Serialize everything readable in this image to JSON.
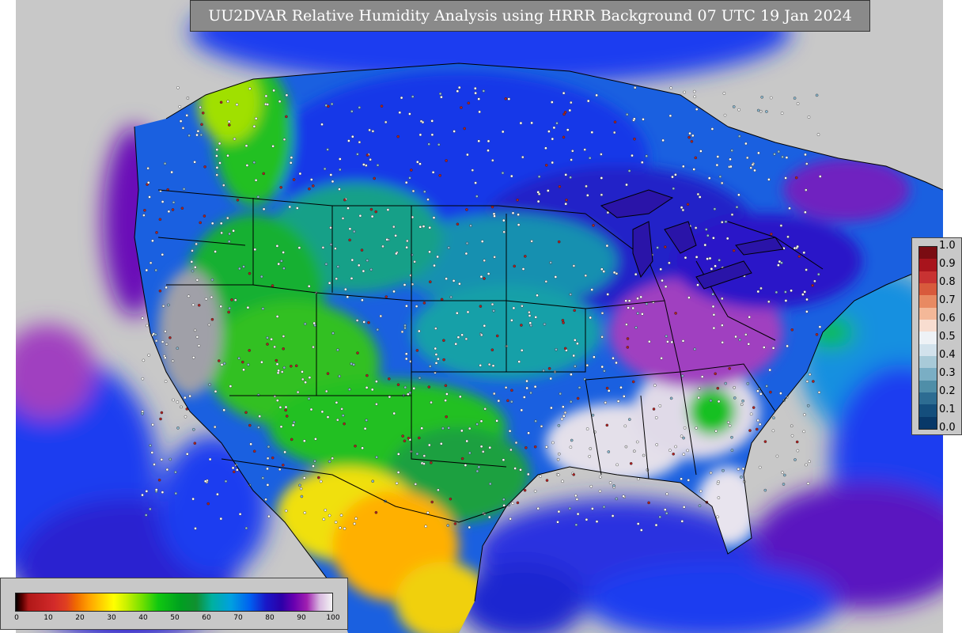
{
  "title": "UU2DVAR Relative Humidity Analysis using HRRR Background 07 UTC 19 Jan 2024",
  "legend_right": {
    "ticks": [
      "1.0",
      "0.9",
      "0.8",
      "0.7",
      "0.6",
      "0.5",
      "0.4",
      "0.3",
      "0.2",
      "0.1",
      "0.0"
    ],
    "colors": [
      "#7a0c12",
      "#a8141c",
      "#c83232",
      "#d85a3c",
      "#e88a62",
      "#f4b898",
      "#f8ddd0",
      "#eef2f6",
      "#d2e2ec",
      "#a8cad8",
      "#7aaec4",
      "#4f8ea8",
      "#2d6c92",
      "#144e7c",
      "#083868"
    ]
  },
  "legend_bottom": {
    "ticks": [
      "0",
      "10",
      "20",
      "30",
      "40",
      "50",
      "60",
      "70",
      "80",
      "90",
      "100"
    ]
  },
  "map_colors": {
    "ocean_neutral": "#c8c8c8",
    "humid_blue": "#1a3cf0",
    "humid_purple": "#6a10b8",
    "mid_green": "#18c020",
    "mid_teal": "#1890a0",
    "dry_yellow": "#f0e010",
    "dry_orange": "#ff9000",
    "saturated_white": "#e8e8ec"
  }
}
